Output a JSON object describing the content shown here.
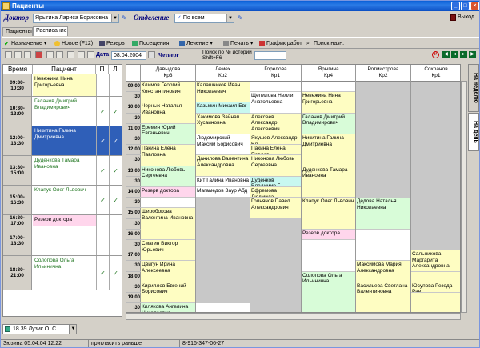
{
  "window": {
    "title": "Пациенты"
  },
  "filters": {
    "doctor_label": "Доктор",
    "doctor_value": "Ярыгина Лариса Борисовна",
    "dept_label": "Отделение",
    "dept_value": "По всем",
    "exit_label": "Выход"
  },
  "tabs": [
    {
      "label": "Пациенты"
    },
    {
      "label": "Расписание"
    }
  ],
  "toolbar": [
    "Назначение",
    "Новое (F12)",
    "Резерв",
    "Посещения",
    "Лечение",
    "Печать",
    "График работ",
    "Поиск назн."
  ],
  "toolbar2": {
    "date_label": "Дата",
    "date_value": "08.04.2004",
    "weekday": "Четверг",
    "search_hint": "Поиск по № истории",
    "search_hint2": "Shift+F6"
  },
  "left_headers": [
    "Время",
    "Пациент",
    "П",
    "Л"
  ],
  "left_rows": [
    {
      "time": "09:30-10:30",
      "patient": "Невежина Нина Григорьевна",
      "c1": "",
      "c2": ""
    },
    {
      "time": "10:30-12:00",
      "patient": "Галанов Дмитрий Владимирович",
      "c1": "✓",
      "c2": "✓"
    },
    {
      "time": "12:00-13:30",
      "patient": "Никитина Галина Дмитриевна",
      "c1": "✓",
      "c2": "✓"
    },
    {
      "time": "13:30-15:00",
      "patient": "Дуденкова Тамара Ивановна",
      "c1": "✓",
      "c2": "✓"
    },
    {
      "time": "15:00-16:30",
      "patient": "Клапук Олег Львович",
      "c1": "✓",
      "c2": "✓"
    },
    {
      "time": "16:30-17:00",
      "patient": "Резерв доктора",
      "c1": "",
      "c2": ""
    },
    {
      "time": "17:00-18:30",
      "patient": "",
      "c1": "",
      "c2": ""
    },
    {
      "time": "18:30-21:00",
      "patient": "Солопова Ольга Ильинична",
      "c1": "✓",
      "c2": "✓"
    }
  ],
  "grid_headers": [
    {
      "name": "Давыдова",
      "room": "Кр3"
    },
    {
      "name": "Лемех",
      "room": "Кр2"
    },
    {
      "name": "Горелова",
      "room": "Кр1"
    },
    {
      "name": "Ярыгина",
      "room": "Кр4"
    },
    {
      "name": "Ротмистрова",
      "room": "Кр2"
    },
    {
      "name": "Сохранов",
      "room": "Кр1"
    }
  ],
  "grid_times": [
    "09:00",
    ":30",
    "10:00",
    ":30",
    "11:00",
    ":30",
    "12:00",
    ":30",
    "13:00",
    ":30",
    "14:00",
    ":30",
    "15:00",
    ":30",
    "16:00",
    ":30",
    "17:00",
    ":30",
    "18:00",
    ":30",
    "19:00",
    ":30"
  ],
  "grid_cols": [
    [
      {
        "t": "Климов Георгий Константинович",
        "c": "y",
        "r": 2
      },
      {
        "t": "Черных Наталья Ивановна",
        "c": "y",
        "r": 2
      },
      {
        "t": "Еремин Юрий Евгеньевич",
        "c": "g",
        "r": 2
      },
      {
        "t": "Пакина Елена Павловна",
        "c": "y",
        "r": 2
      },
      {
        "t": "Никонова Любовь Сергеевна",
        "c": "g",
        "r": 2
      },
      {
        "t": "Резерв доктора",
        "c": "pk",
        "r": 1
      },
      {
        "t": "",
        "c": "w",
        "r": 1
      },
      {
        "t": "Широбокова Валентина Ивановна",
        "c": "y",
        "r": 3
      },
      {
        "t": "Смагин Виктор Юрьевич",
        "c": "y",
        "r": 2
      },
      {
        "t": "Цвигун Ирина Алексеевна",
        "c": "y",
        "r": 2
      },
      {
        "t": "Кириллов Евгений Борисович",
        "c": "y",
        "r": 2
      },
      {
        "t": "Килякова Ангелина Николаевна",
        "c": "g",
        "r": 2
      }
    ],
    [
      {
        "t": "Калашников Иван Николаевич",
        "c": "y",
        "r": 2
      },
      {
        "t": "Казьмин Михаил Евг",
        "c": "cy",
        "r": 1
      },
      {
        "t": "Хакимова Зайнап Хусаиновна",
        "c": "y",
        "r": 2
      },
      {
        "t": "Людомирский Максим Борисович",
        "c": "w",
        "r": 2
      },
      {
        "t": "Даниловa Валентина Александровна",
        "c": "y",
        "r": 2
      },
      {
        "t": "Кит Галина Ивановна",
        "c": "w",
        "r": 1
      },
      {
        "t": "Магамедов Заур Абд",
        "c": "w",
        "r": 1
      },
      {
        "t": "",
        "c": "gr",
        "r": 10
      }
    ],
    [
      {
        "t": "",
        "c": "w",
        "r": 1
      },
      {
        "t": "Щепилова Нелли Анатольевна",
        "c": "w",
        "r": 2
      },
      {
        "t": "Алексеев Александр Алексеевич",
        "c": "y",
        "r": 2
      },
      {
        "t": "Якушев Александр Вл",
        "c": "y",
        "r": 1
      },
      {
        "t": "Пакина Елена Павлов",
        "c": "y",
        "r": 1
      },
      {
        "t": "Никонова Любовь Сергеевна",
        "c": "y",
        "r": 2
      },
      {
        "t": "Дуденков Владимир Г",
        "c": "cy",
        "r": 1
      },
      {
        "t": "Ефремова Людмила",
        "c": "y",
        "r": 1
      },
      {
        "t": "Гольянов Павел Александрович",
        "c": "y",
        "r": 2
      },
      {
        "t": "",
        "c": "gr",
        "r": 9
      }
    ],
    [
      {
        "t": "",
        "c": "w",
        "r": 1
      },
      {
        "t": "Невежина Нина Григорьевна",
        "c": "y",
        "r": 2
      },
      {
        "t": "Галанов Дмитрий Владимирович",
        "c": "g",
        "r": 2
      },
      {
        "t": "Никитина Галина Дмитриевна",
        "c": "y",
        "r": 3
      },
      {
        "t": "Дуденкова Тамара Ивановна",
        "c": "y",
        "r": 3
      },
      {
        "t": "Клапук Олег Львович",
        "c": "y",
        "r": 3
      },
      {
        "t": "Резерв доктора",
        "c": "pk",
        "r": 1
      },
      {
        "t": "",
        "c": "w",
        "r": 3
      },
      {
        "t": "Солопова Ольга Ильинична",
        "c": "g",
        "r": 4
      }
    ],
    [
      {
        "t": "",
        "c": "gr",
        "r": 11
      },
      {
        "t": "Дедова Наталья Николаевна",
        "c": "g",
        "r": 3
      },
      {
        "t": "",
        "c": "w",
        "r": 3
      },
      {
        "t": "Максимова Мария Александровна",
        "c": "y",
        "r": 2
      },
      {
        "t": "Васильева Светлана Валентиновна",
        "c": "y",
        "r": 3
      }
    ],
    [
      {
        "t": "",
        "c": "gr",
        "r": 16
      },
      {
        "t": "Сальникова Маргарита Александровна",
        "c": "y",
        "r": 2
      },
      {
        "t": "",
        "c": "y",
        "r": 1
      },
      {
        "t": "Юсупова Резеда Рав",
        "c": "y",
        "r": 1
      },
      {
        "t": "",
        "c": "y",
        "r": 2
      }
    ]
  ],
  "side_tabs": [
    "На неделю",
    "На день"
  ],
  "bottom_doc": "18.39 Лузик О. С.",
  "status": [
    "Зюзина 05.04.04 12:22",
    "пригласить раньше",
    "8-916-347-06-27"
  ]
}
